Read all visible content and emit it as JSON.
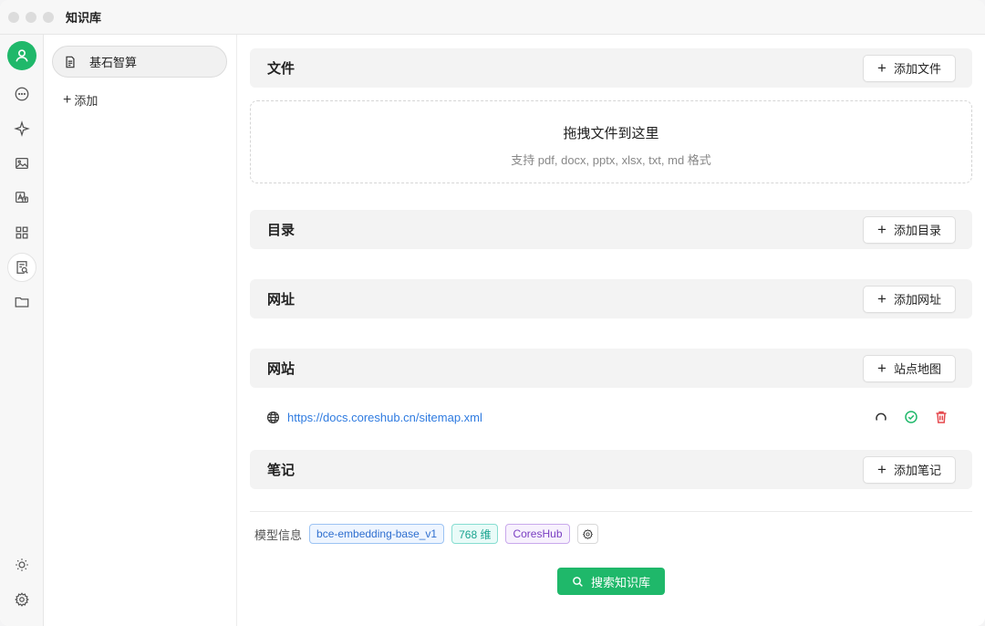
{
  "window": {
    "title": "知识库"
  },
  "sidebar_icons": [
    "user-icon",
    "chat-icon",
    "sparkle-icon",
    "image-icon",
    "translate-icon",
    "apps-icon",
    "knowledge-icon",
    "folder-icon",
    "sun-icon",
    "gear-icon"
  ],
  "knowledge_bases": [
    {
      "name": "基石智算"
    }
  ],
  "add_kb_label": "添加",
  "sections": {
    "files": {
      "title": "文件",
      "button": "添加文件"
    },
    "dropzone": {
      "title": "拖拽文件到这里",
      "subtitle": "支持 pdf, docx, pptx, xlsx, txt, md 格式"
    },
    "directory": {
      "title": "目录",
      "button": "添加目录"
    },
    "url": {
      "title": "网址",
      "button": "添加网址"
    },
    "website": {
      "title": "网站",
      "button": "站点地图"
    },
    "notes": {
      "title": "笔记",
      "button": "添加笔记"
    }
  },
  "website_items": [
    {
      "url": "https://docs.coreshub.cn/sitemap.xml"
    }
  ],
  "model_info": {
    "label": "模型信息",
    "model": "bce-embedding-base_v1",
    "dimensions": "768 维",
    "provider": "CoresHub"
  },
  "search_button": "搜索知识库",
  "colors": {
    "accent": "#1fb86a",
    "link": "#2f7be0",
    "danger": "#e5484d"
  }
}
